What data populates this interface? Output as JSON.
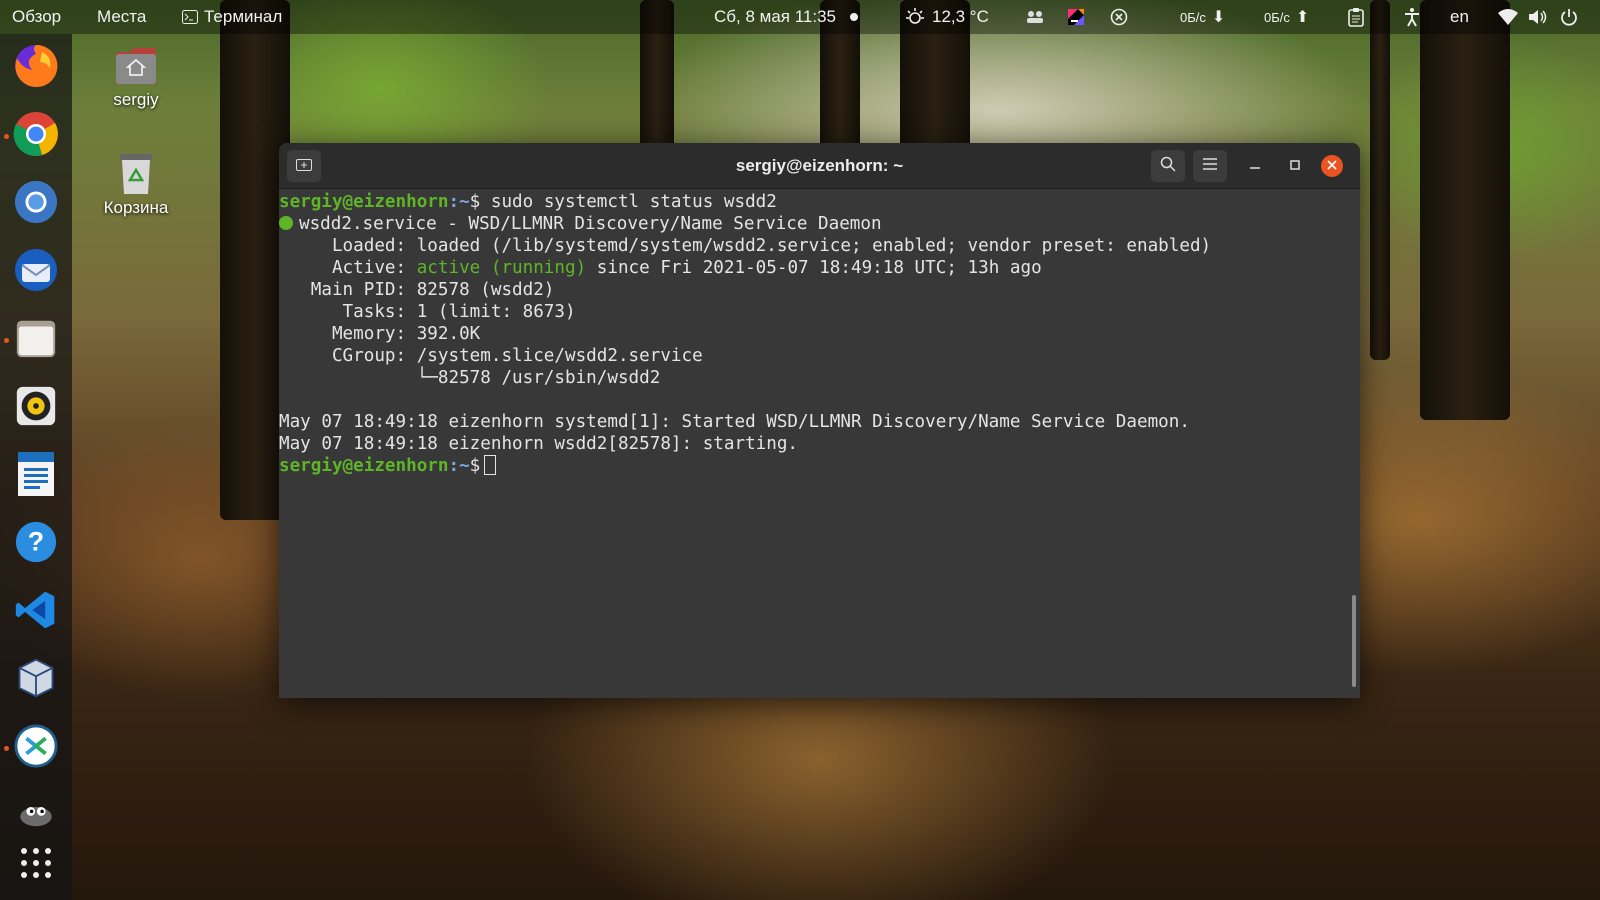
{
  "topbar": {
    "overview": "Обзор",
    "places": "Места",
    "app_name": "Терминал",
    "datetime": "Сб, 8 мая  11:35",
    "weather": "12,3 °C",
    "net_down": "0Б/с",
    "net_up": "0Б/с",
    "language": "en"
  },
  "desktop": {
    "home_label": "sergiy",
    "trash_label": "Корзина"
  },
  "dock": {
    "items": [
      {
        "name": "firefox",
        "running": false
      },
      {
        "name": "chrome",
        "running": true
      },
      {
        "name": "chromium",
        "running": false
      },
      {
        "name": "thunderbird",
        "running": false
      },
      {
        "name": "files",
        "running": true
      },
      {
        "name": "rhythmbox",
        "running": false
      },
      {
        "name": "libreoffice-writer",
        "running": false
      },
      {
        "name": "help",
        "running": false
      },
      {
        "name": "vscode",
        "running": false
      },
      {
        "name": "virtualbox",
        "running": false
      },
      {
        "name": "remmina",
        "running": true
      },
      {
        "name": "gimp",
        "running": false
      },
      {
        "name": "show-apps",
        "running": false
      }
    ]
  },
  "terminal": {
    "title": "sergiy@eizenhorn: ~",
    "prompt_user": "sergiy@eizenhorn",
    "prompt_path": ":~",
    "prompt_symbol": "$",
    "command": " sudo systemctl status wsdd2",
    "service_line": "wsdd2.service - WSD/LLMNR Discovery/Name Service Daemon",
    "loaded": "     Loaded: loaded (/lib/systemd/system/wsdd2.service; enabled; vendor preset: enabled)",
    "active_label": "     Active: ",
    "active_state": "active (running)",
    "active_rest": " since Fri 2021-05-07 18:49:18 UTC; 13h ago",
    "main_pid": "   Main PID: 82578 (wsdd2)",
    "tasks": "      Tasks: 1 (limit: 8673)",
    "memory": "     Memory: 392.0K",
    "cgroup": "     CGroup: /system.slice/wsdd2.service",
    "cgroup_child": "             └─82578 /usr/sbin/wsdd2",
    "log1": "May 07 18:49:18 eizenhorn systemd[1]: Started WSD/LLMNR Discovery/Name Service Daemon.",
    "log2": "May 07 18:49:18 eizenhorn wsdd2[82578]: starting."
  },
  "colors": {
    "prompt_green": "#5fb528",
    "prompt_blue": "#7aa6da",
    "close_orange": "#e95420",
    "terminal_bg": "#383838"
  }
}
